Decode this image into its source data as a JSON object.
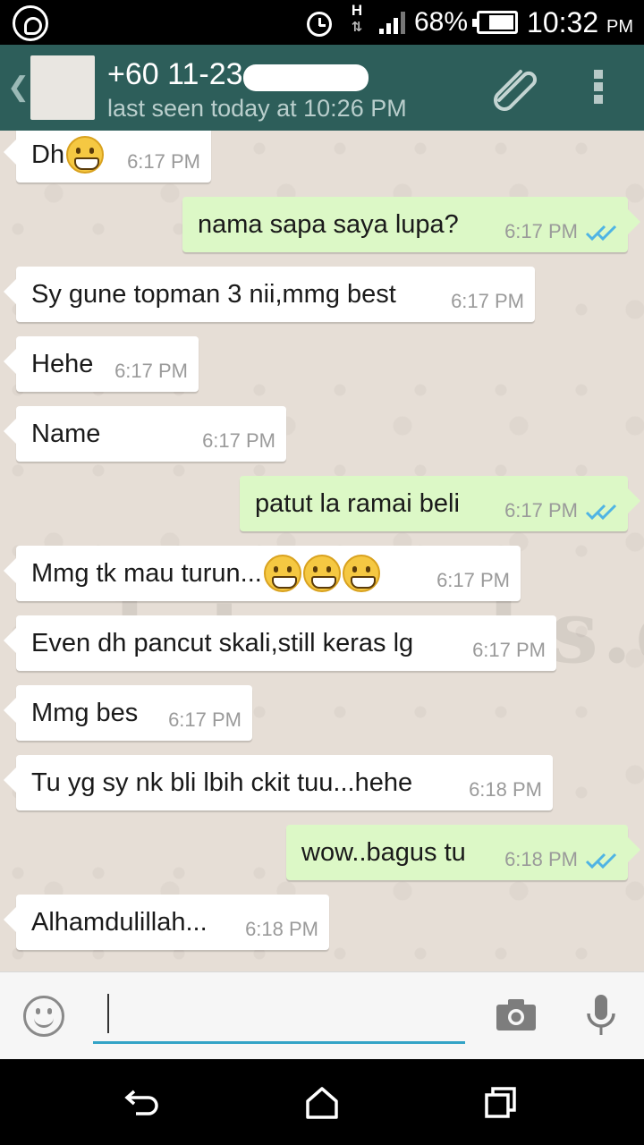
{
  "status_bar": {
    "network_type": "H",
    "battery": "68%",
    "time": "10:32",
    "time_suffix": "PM",
    "icons": [
      "whatsapp-icon",
      "alarm-icon",
      "signal-icon",
      "battery-icon"
    ]
  },
  "header": {
    "contact_name": "+60 11-23",
    "last_seen": "last seen today at 10:26 PM",
    "icons": [
      "back-chevron-icon",
      "avatar",
      "attach-icon",
      "overflow-menu-icon"
    ]
  },
  "messages": [
    {
      "dir": "in",
      "text": "Dh",
      "emoji": 1,
      "time": "6:17 PM"
    },
    {
      "dir": "out",
      "text": "nama sapa saya lupa?",
      "emoji": 0,
      "time": "6:17 PM"
    },
    {
      "dir": "in",
      "text": "Sy gune topman 3 nii,mmg best",
      "emoji": 0,
      "time": "6:17 PM"
    },
    {
      "dir": "in",
      "text": "Hehe",
      "emoji": 0,
      "time": "6:17 PM"
    },
    {
      "dir": "in",
      "text": "Name",
      "emoji": 0,
      "time": "6:17 PM"
    },
    {
      "dir": "out",
      "text": "patut la ramai beli",
      "emoji": 0,
      "time": "6:17 PM"
    },
    {
      "dir": "in",
      "text": "Mmg tk mau turun...",
      "emoji": 3,
      "time": "6:17 PM"
    },
    {
      "dir": "in",
      "text": "Even dh pancut skali,still keras lg",
      "emoji": 0,
      "time": "6:17 PM"
    },
    {
      "dir": "in",
      "text": "Mmg bes",
      "emoji": 0,
      "time": "6:17 PM"
    },
    {
      "dir": "in",
      "text": "Tu yg sy nk bli lbih ckit tuu...hehe",
      "emoji": 0,
      "time": "6:18 PM"
    },
    {
      "dir": "out",
      "text": "wow..bagus tu",
      "emoji": 0,
      "time": "6:18 PM"
    },
    {
      "dir": "in",
      "text": "Alhamdulillah...",
      "emoji": 0,
      "time": "6:18 PM"
    }
  ],
  "watermark": "alatanseks.com",
  "colors": {
    "header_bg": "#2d5e5a",
    "outgoing_bubble": "#dcf8c6",
    "incoming_bubble": "#ffffff",
    "read_ticks": "#4fb4e4",
    "input_underline": "#33a3c6"
  },
  "input_bar": {
    "message_value": "",
    "icons": [
      "emoji-icon",
      "camera-icon",
      "microphone-icon"
    ]
  },
  "nav_bar": {
    "icons": [
      "back-icon",
      "home-icon",
      "recents-icon"
    ]
  }
}
